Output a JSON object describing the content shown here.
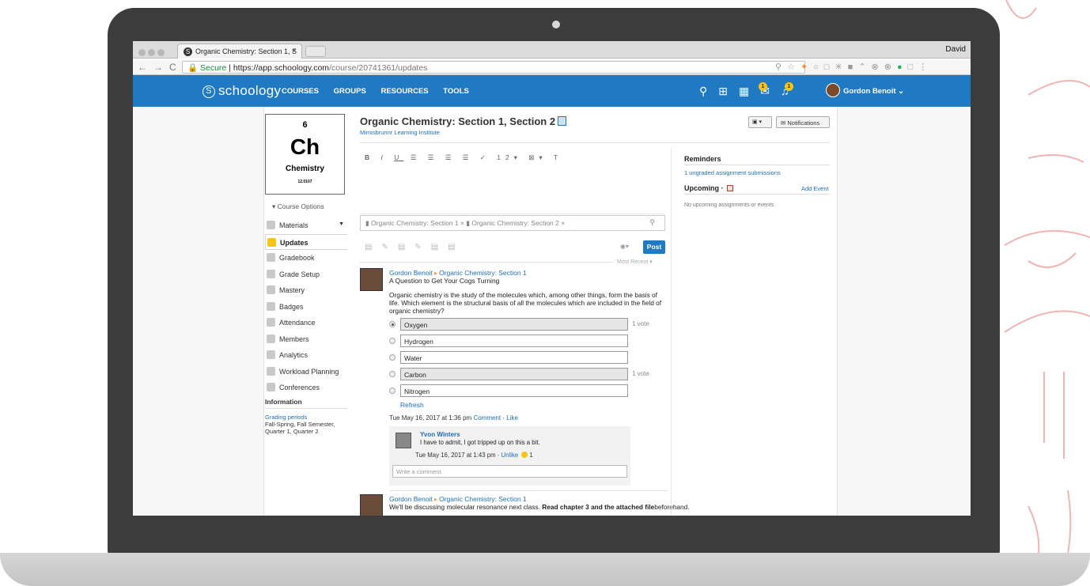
{
  "browser": {
    "tab_title": "Organic Chemistry: Section 1, S",
    "user": "David",
    "url_secure": "Secure",
    "url_host": "https://app.schoology.com",
    "url_path": "/course/20741361/updates"
  },
  "nav": {
    "logo": "schoology",
    "links": [
      "COURSES",
      "GROUPS",
      "RESOURCES",
      "TOOLS"
    ],
    "messages_badge": "1",
    "notifications_badge": "1",
    "user_name": "Gordon Benoit"
  },
  "course_card": {
    "number": "6",
    "symbol": "Ch",
    "name": "Chemistry",
    "mass": "12.0107"
  },
  "sidebar": {
    "course_options": "Course Options",
    "items": [
      {
        "label": "Materials",
        "icon": "materials-icon"
      },
      {
        "label": "Updates",
        "icon": "updates-icon"
      },
      {
        "label": "Gradebook",
        "icon": "gradebook-icon"
      },
      {
        "label": "Grade Setup",
        "icon": "grade-setup-icon"
      },
      {
        "label": "Mastery",
        "icon": "mastery-icon"
      },
      {
        "label": "Badges",
        "icon": "badges-icon"
      },
      {
        "label": "Attendance",
        "icon": "attendance-icon"
      },
      {
        "label": "Members",
        "icon": "members-icon"
      },
      {
        "label": "Analytics",
        "icon": "analytics-icon"
      },
      {
        "label": "Workload Planning",
        "icon": "workload-icon"
      },
      {
        "label": "Conferences",
        "icon": "conferences-icon"
      }
    ],
    "info_heading": "Information",
    "grading_label": "Grading periods",
    "grading_value": "Fall-Spring, Fall Semester, Quarter 1, Quarter 2"
  },
  "course": {
    "title": "Organic Chemistry: Section 1, Section 2",
    "school": "Mimisbrunnr Learning Institute",
    "notifications_button": "Notifications"
  },
  "composer": {
    "toolbar_font_size": "12",
    "recipient_1": "Organic Chemistry: Section 1",
    "recipient_2": "Organic Chemistry: Section 2",
    "post_button": "Post",
    "sort_label": "Most Recent"
  },
  "post1": {
    "author": "Gordon Benoit",
    "target": "Organic Chemistry: Section 1",
    "title": "A Question to Get Your Cogs Turning",
    "body": "Organic chemistry is the study of the molecules which, among other things, form the basis of life. Which element is the structural basis of all the molecules which are included in the field of organic chemistry?",
    "options": [
      {
        "label": "Oxygen",
        "votes": "1 vote"
      },
      {
        "label": "Hydrogen",
        "votes": ""
      },
      {
        "label": "Water",
        "votes": ""
      },
      {
        "label": "Carbon",
        "votes": "1 vote"
      },
      {
        "label": "Nitrogen",
        "votes": ""
      }
    ],
    "refresh": "Refresh",
    "timestamp": "Tue May 16, 2017 at 1:36 pm",
    "comment_link": "Comment",
    "like_link": "Like",
    "comment": {
      "author": "Yvon Winters",
      "text": "I have to admit, I got tripped up on this a bit.",
      "timestamp": "Tue May 16, 2017 at 1:43 pm",
      "unlike": "Unlike",
      "likes": "1",
      "placeholder": "Write a comment"
    }
  },
  "post2": {
    "author": "Gordon Benoit",
    "target": "Organic Chemistry: Section 1",
    "body_start": "We'll be discussing molecular resonance next class. ",
    "body_bold": "Read chapter 3 and the attached file",
    "body_end": "beforehand."
  },
  "right": {
    "reminders": "Reminders",
    "reminder_link": "1 ungraded assignment submissions",
    "upcoming": "Upcoming",
    "add_event": "Add Event",
    "none": "No upcoming assignments or events"
  },
  "colors": {
    "brand": "#1f7ac3",
    "badge": "#f5c518",
    "link": "#1f6fb5"
  }
}
